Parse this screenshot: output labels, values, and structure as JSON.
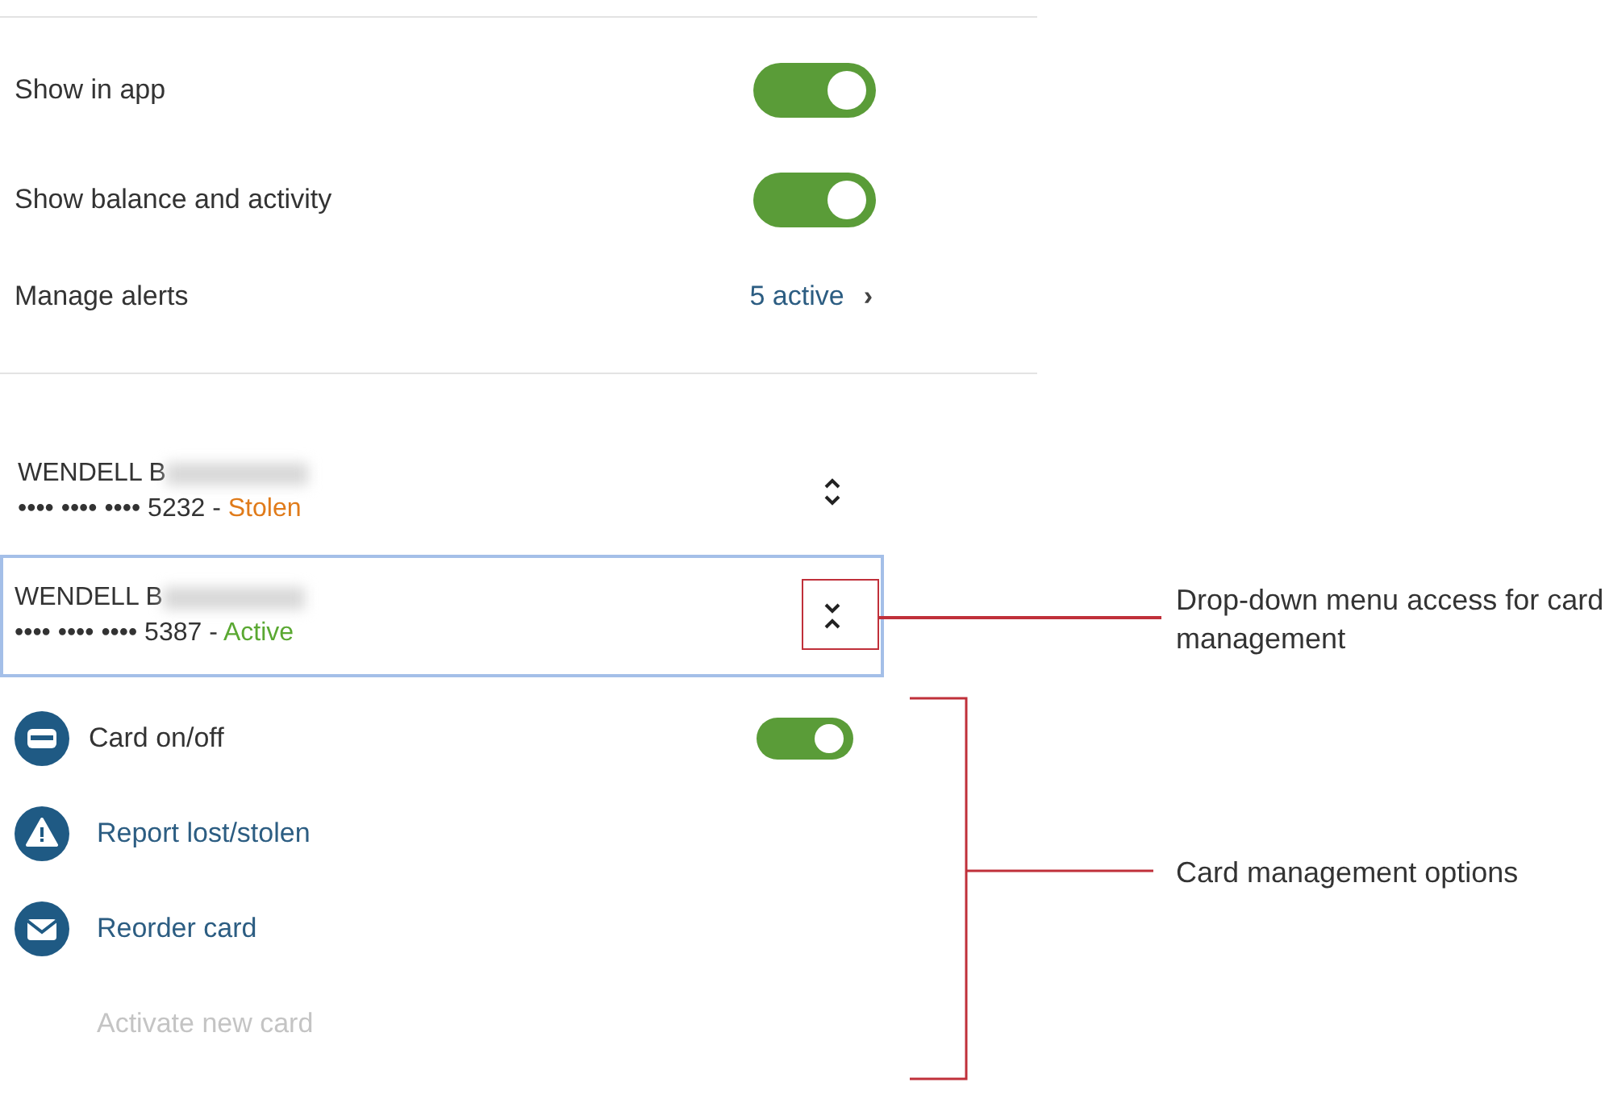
{
  "settings": [
    {
      "kind": "toggle",
      "label": "Show in app",
      "on": true
    },
    {
      "kind": "toggle",
      "label": "Show balance and activity",
      "on": true
    },
    {
      "kind": "link",
      "label": "Manage alerts",
      "value": "5 active",
      "arrow": "›"
    }
  ],
  "cards": [
    {
      "name": "WENDELL B",
      "number": "•••• •••• •••• 5232",
      "separator": "-",
      "status": "Stolen",
      "color": "#e07b1a",
      "expanded": false,
      "selected": false
    },
    {
      "name": "WENDELL B",
      "number": "•••• •••• •••• 5387",
      "separator": "-",
      "status": "Active",
      "color": "#5aa832",
      "expanded": true,
      "selected": true
    }
  ],
  "options": [
    {
      "kind": "toggle",
      "label": "Card on/off",
      "on": true,
      "disabled": false
    },
    {
      "kind": "alert",
      "label": "Report lost/stolen",
      "disabled": false
    },
    {
      "kind": "mail",
      "label": "Reorder card",
      "disabled": false
    },
    {
      "kind": "plain",
      "label": "Activate new card",
      "disabled": true
    }
  ],
  "callouts": [
    {
      "kind": "frame",
      "text": "Drop-down menu access for card management"
    },
    {
      "kind": "bracket",
      "text": "Card management options"
    }
  ]
}
